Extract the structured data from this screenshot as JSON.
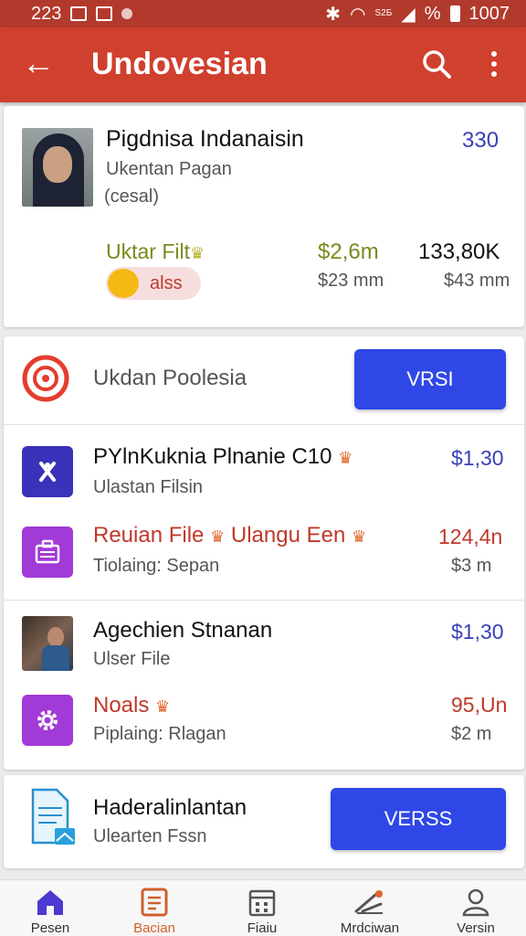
{
  "status_bar": {
    "time": "223",
    "signal_tiny": "S2Б",
    "battery_text": "%",
    "clock": "1007"
  },
  "app_bar": {
    "title": "Undovesian"
  },
  "profile_card": {
    "name": "Pigdnisa Indanaisin",
    "count": "330",
    "subtitle": "Ukentan Pagan",
    "note": "(cesal)",
    "label": "Uktar Filt",
    "amount1": "$2,6m",
    "amount1_sub": "$23 mm",
    "amount2": "133,80K",
    "amount2_sub": "$43 mm",
    "pill_label": "alss"
  },
  "section_header": {
    "title": "Ukdan Poolesia",
    "button": "VRSI"
  },
  "items": [
    {
      "title": "PYlnKuknia Plnanie C10",
      "subtitle": "Ulastan Filsin",
      "value": "$1,30",
      "value_sub": ""
    },
    {
      "title": "Reuian File",
      "title2": "Ulangu Een",
      "subtitle": "Tiolaing: Sepan",
      "value": "124,4n",
      "value_sub": "$3 m"
    },
    {
      "title": "Agechien Stnanan",
      "subtitle": "Ulser File",
      "value": "$1,30",
      "value_sub": ""
    },
    {
      "title": "Noals",
      "subtitle": "Piplaing: Rlagan",
      "value": "95,Un",
      "value_sub": "$2 m"
    }
  ],
  "bottom_card": {
    "title": "Haderalinlantan",
    "subtitle": "Ulearten Fssn",
    "button": "VERSS"
  },
  "nav": [
    {
      "label": "Pesen",
      "icon": "home-icon"
    },
    {
      "label": "Bacian",
      "icon": "document-icon"
    },
    {
      "label": "Fiaiu",
      "icon": "calendar-icon"
    },
    {
      "label": "Mrdciwan",
      "icon": "tools-icon"
    },
    {
      "label": "Versin",
      "icon": "profile-icon"
    }
  ],
  "colors": {
    "app_bar": "#d0402e",
    "status_bar": "#b23a2c",
    "accent_button": "#2f47e6",
    "blue_value": "#3b3fb8",
    "red_value": "#c0392b",
    "nav_active": "#d0602c"
  }
}
